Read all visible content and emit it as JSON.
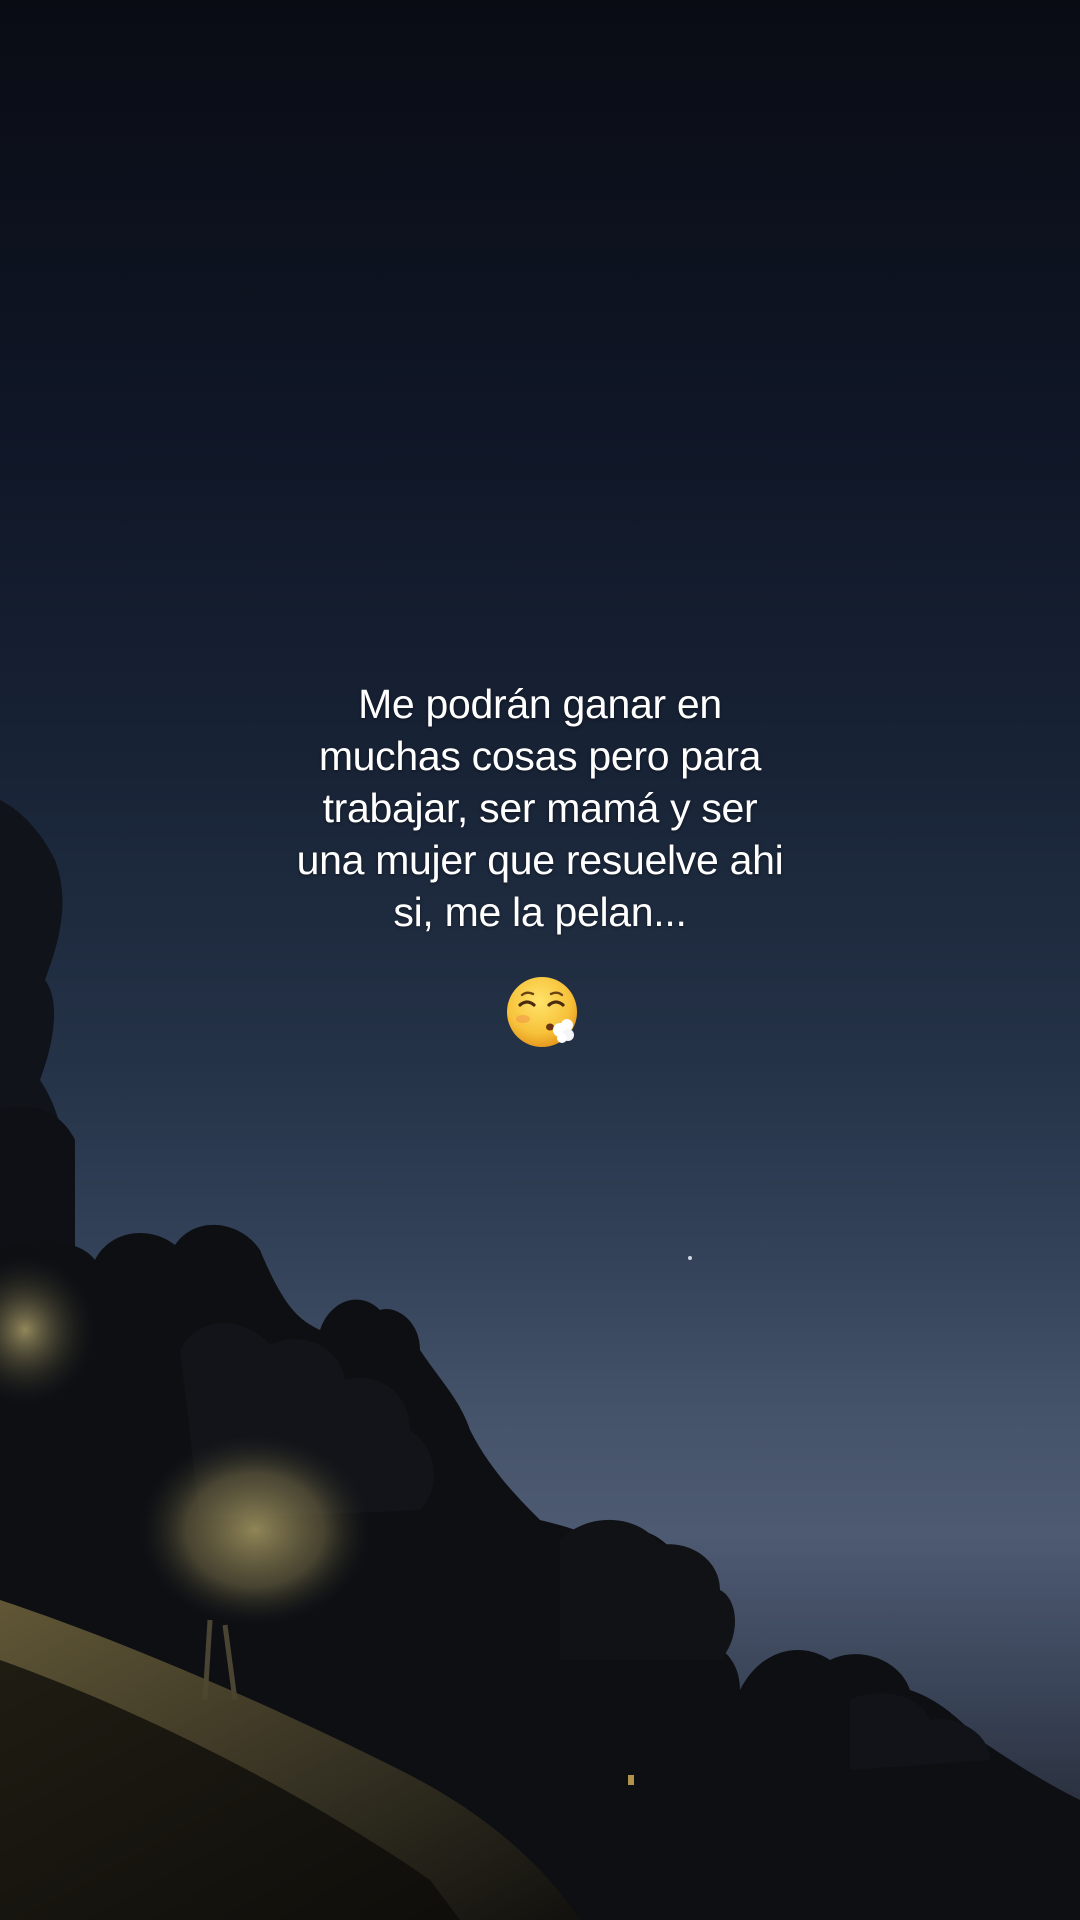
{
  "caption": {
    "lines": [
      "Me podrán ganar en",
      "muchas cosas pero para",
      "trabajar, ser mamá y ser",
      "una mujer que resuelve ahi",
      "si, me la pelan..."
    ]
  },
  "emoji": {
    "icon": "face-exhaling-icon"
  },
  "colors": {
    "sky_top": "#0a0c14",
    "sky_horizon": "#4d5a72",
    "foliage_dark": "#0e0f12",
    "foliage_lit": "#8a7f52",
    "text": "#ffffff"
  }
}
